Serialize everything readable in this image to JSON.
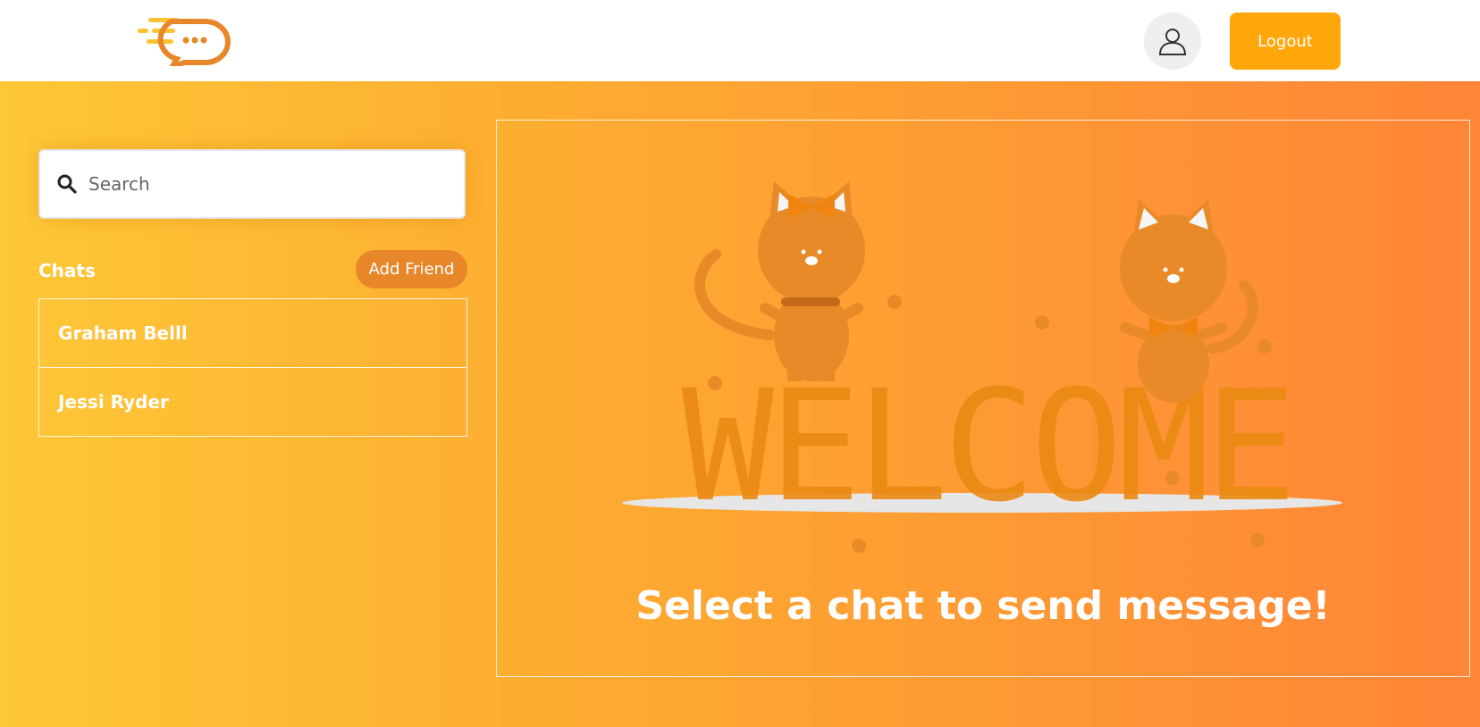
{
  "header": {
    "logo_icon": "chat-bubble-logo-icon",
    "profile_icon": "user-icon",
    "logout_label": "Logout",
    "accent_color": "#ffa60a"
  },
  "sidebar": {
    "search": {
      "placeholder": "Search",
      "value": "",
      "icon": "search-icon"
    },
    "chats_title": "Chats",
    "add_friend_label": "Add Friend",
    "chats": [
      {
        "name": "Graham Belll"
      },
      {
        "name": "Jessi Ryder"
      }
    ]
  },
  "main": {
    "illustration": "welcome-cats-illustration",
    "welcome_text": "WELCOME",
    "empty_message": "Select a chat to send message!"
  }
}
